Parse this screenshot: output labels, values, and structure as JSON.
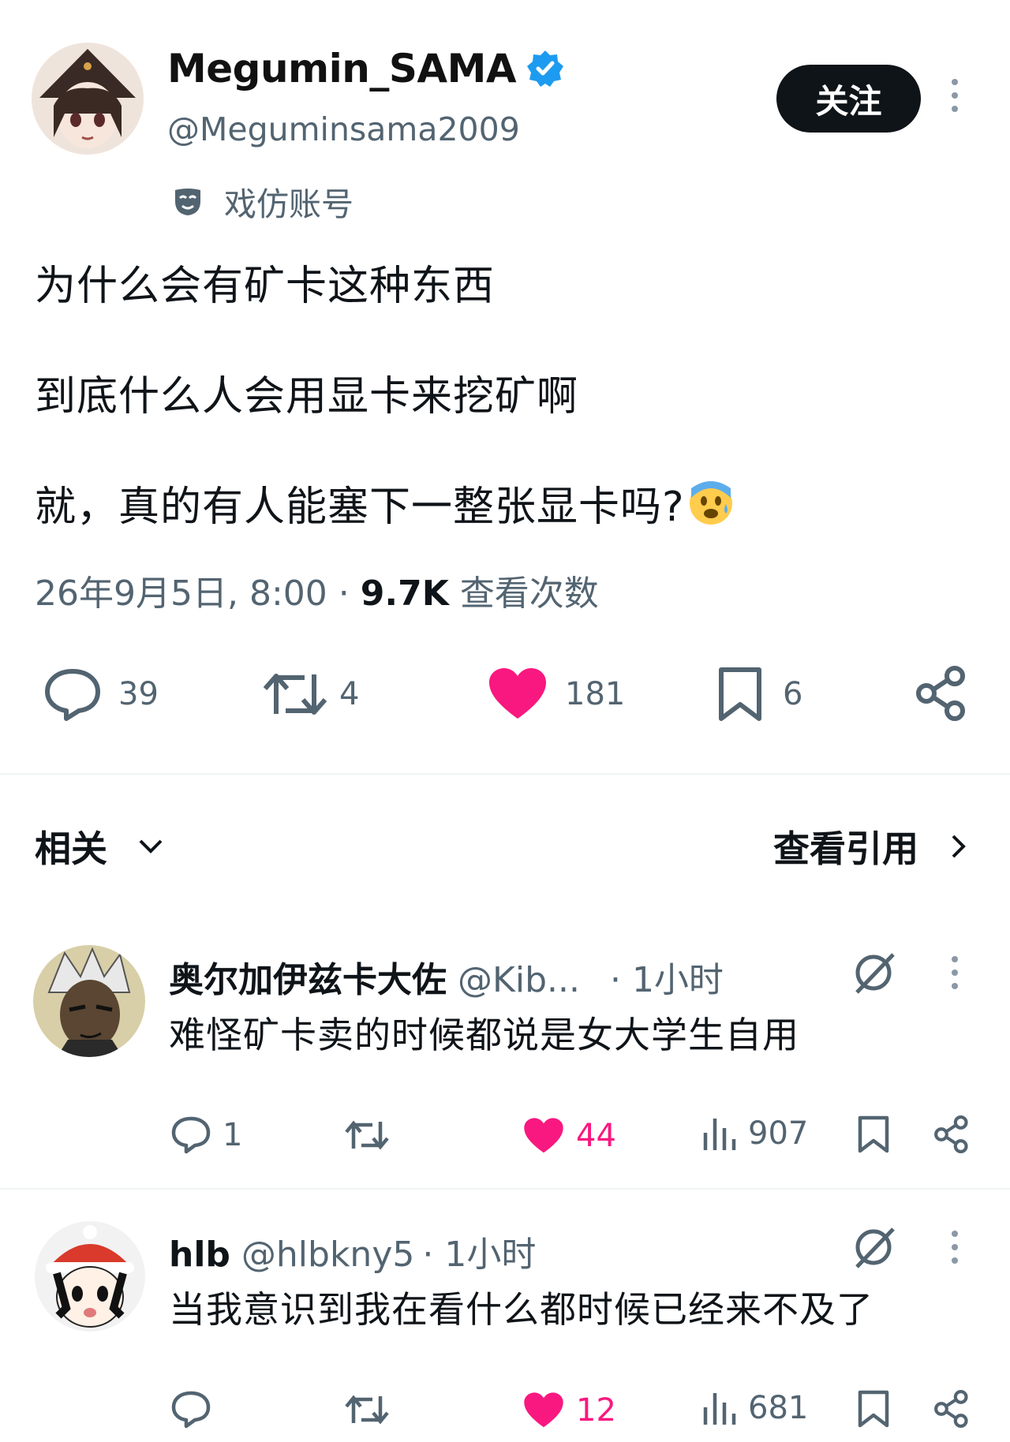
{
  "author": {
    "display_name": "Megumin_SAMA",
    "handle": "@Meguminsama2009",
    "label": "戏仿账号",
    "follow_label": "关注"
  },
  "tweet": {
    "lines": [
      "为什么会有矿卡这种东西",
      "到底什么人会用显卡来挖矿啊",
      "就，真的有人能塞下一整张显卡吗?"
    ],
    "emoji": "😰",
    "date": "26年9月5日, 8:00",
    "separator": "·",
    "views": "9.7K",
    "views_label": "查看次数"
  },
  "actions": {
    "replies": "39",
    "retweets": "4",
    "likes": "181",
    "bookmarks": "6"
  },
  "section": {
    "related_label": "相关",
    "quotes_label": "查看引用"
  },
  "replies": [
    {
      "name": "奥尔加伊兹卡大佐",
      "handle": "@Kib...",
      "time": "· 1小时",
      "text": "难怪矿卡卖的时候都说是女大学生自用",
      "replies": "1",
      "likes": "44",
      "views": "907"
    },
    {
      "name": "hlb",
      "handle": "@hlbkny5",
      "time": "· 1小时",
      "text": "当我意识到我在看什么都时候已经来不及了",
      "replies": "",
      "likes": "12",
      "views": "681"
    }
  ],
  "colors": {
    "like": "#f91880",
    "verified": "#1d9bf0",
    "text": "#0f1419",
    "secondary": "#536471"
  }
}
